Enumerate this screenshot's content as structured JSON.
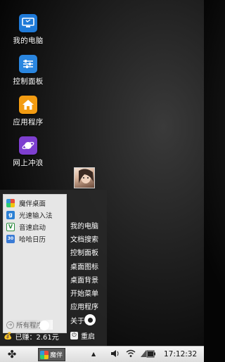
{
  "desktop": {
    "icons": [
      {
        "label": "我的电脑",
        "color": "#1f7ad8",
        "icon": "computer-icon"
      },
      {
        "label": "控制面板",
        "color": "#2a86e0",
        "icon": "sliders-icon"
      },
      {
        "label": "应用程序",
        "color": "#f39c12",
        "icon": "home-icon"
      },
      {
        "label": "网上冲浪",
        "color": "#7e3fd0",
        "icon": "planet-icon"
      }
    ]
  },
  "start_menu": {
    "apps": [
      {
        "label": "魔伴桌面",
        "icon": "mobanzhuomian-icon"
      },
      {
        "label": "光速输入法",
        "icon": "input-method-icon",
        "glyph": "g"
      },
      {
        "label": "音速启动",
        "icon": "launcher-icon",
        "glyph": "V"
      },
      {
        "label": "哈哈日历",
        "icon": "calendar-icon",
        "glyph": "30"
      }
    ],
    "all_programs": "所有程序",
    "earnings": "已赚：2.61元",
    "right_items": [
      "我的电脑",
      "文档搜索",
      "控制面板",
      "桌面图标",
      "桌面背景",
      "开始菜单",
      "应用程序",
      "关于"
    ],
    "restart": "重启"
  },
  "taskbar": {
    "start_glyph": "✤",
    "app_label": "魔伴",
    "clock": "17:12:32"
  }
}
